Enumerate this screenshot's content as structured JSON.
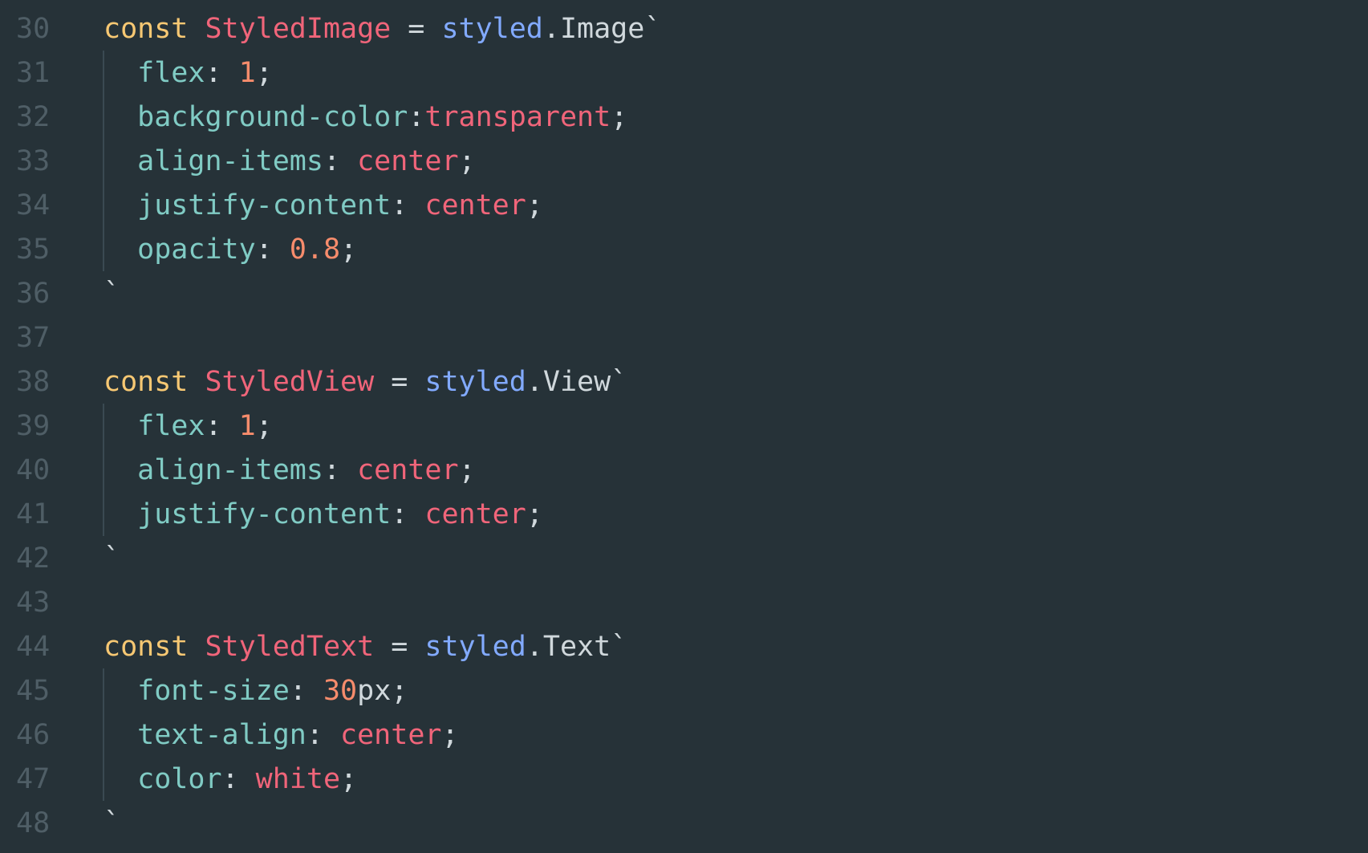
{
  "editor": {
    "background": "#263238",
    "colors": {
      "keyword": "#F7C873",
      "identifier": "#F0657A",
      "function": "#82AAFF",
      "property": "#80CBC4",
      "number": "#F78C6C",
      "value": "#F0657A",
      "punctuation": "#D0D8DC",
      "line_number": "#4F5E66"
    },
    "lines": [
      {
        "num": "30",
        "tokens": [
          {
            "t": "const",
            "c": "kw"
          },
          {
            "t": " "
          },
          {
            "t": "StyledImage",
            "c": "cls"
          },
          {
            "t": " = "
          },
          {
            "t": "styled",
            "c": "fn"
          },
          {
            "t": ".Image`"
          }
        ]
      },
      {
        "num": "31",
        "tokens": [
          {
            "t": "  "
          },
          {
            "t": "flex",
            "c": "prop"
          },
          {
            "t": ": "
          },
          {
            "t": "1",
            "c": "num"
          },
          {
            "t": ";"
          }
        ]
      },
      {
        "num": "32",
        "tokens": [
          {
            "t": "  "
          },
          {
            "t": "background-color",
            "c": "prop"
          },
          {
            "t": ":"
          },
          {
            "t": "transparent",
            "c": "val"
          },
          {
            "t": ";"
          }
        ]
      },
      {
        "num": "33",
        "tokens": [
          {
            "t": "  "
          },
          {
            "t": "align-items",
            "c": "prop"
          },
          {
            "t": ": "
          },
          {
            "t": "center",
            "c": "val"
          },
          {
            "t": ";"
          }
        ]
      },
      {
        "num": "34",
        "tokens": [
          {
            "t": "  "
          },
          {
            "t": "justify-content",
            "c": "prop"
          },
          {
            "t": ": "
          },
          {
            "t": "center",
            "c": "val"
          },
          {
            "t": ";"
          }
        ]
      },
      {
        "num": "35",
        "tokens": [
          {
            "t": "  "
          },
          {
            "t": "opacity",
            "c": "prop"
          },
          {
            "t": ": "
          },
          {
            "t": "0.8",
            "c": "num"
          },
          {
            "t": ";"
          }
        ]
      },
      {
        "num": "36",
        "tokens": [
          {
            "t": "`"
          }
        ]
      },
      {
        "num": "37",
        "tokens": []
      },
      {
        "num": "38",
        "tokens": [
          {
            "t": "const",
            "c": "kw"
          },
          {
            "t": " "
          },
          {
            "t": "StyledView",
            "c": "cls"
          },
          {
            "t": " = "
          },
          {
            "t": "styled",
            "c": "fn"
          },
          {
            "t": ".View`"
          }
        ]
      },
      {
        "num": "39",
        "tokens": [
          {
            "t": "  "
          },
          {
            "t": "flex",
            "c": "prop"
          },
          {
            "t": ": "
          },
          {
            "t": "1",
            "c": "num"
          },
          {
            "t": ";"
          }
        ]
      },
      {
        "num": "40",
        "tokens": [
          {
            "t": "  "
          },
          {
            "t": "align-items",
            "c": "prop"
          },
          {
            "t": ": "
          },
          {
            "t": "center",
            "c": "val"
          },
          {
            "t": ";"
          }
        ]
      },
      {
        "num": "41",
        "tokens": [
          {
            "t": "  "
          },
          {
            "t": "justify-content",
            "c": "prop"
          },
          {
            "t": ": "
          },
          {
            "t": "center",
            "c": "val"
          },
          {
            "t": ";"
          }
        ]
      },
      {
        "num": "42",
        "tokens": [
          {
            "t": "`"
          }
        ]
      },
      {
        "num": "43",
        "tokens": []
      },
      {
        "num": "44",
        "tokens": [
          {
            "t": "const",
            "c": "kw"
          },
          {
            "t": " "
          },
          {
            "t": "StyledText",
            "c": "cls"
          },
          {
            "t": " = "
          },
          {
            "t": "styled",
            "c": "fn"
          },
          {
            "t": ".Text`"
          }
        ]
      },
      {
        "num": "45",
        "tokens": [
          {
            "t": "  "
          },
          {
            "t": "font-size",
            "c": "prop"
          },
          {
            "t": ": "
          },
          {
            "t": "30",
            "c": "num"
          },
          {
            "t": "px;"
          }
        ]
      },
      {
        "num": "46",
        "tokens": [
          {
            "t": "  "
          },
          {
            "t": "text-align",
            "c": "prop"
          },
          {
            "t": ": "
          },
          {
            "t": "center",
            "c": "val"
          },
          {
            "t": ";"
          }
        ]
      },
      {
        "num": "47",
        "tokens": [
          {
            "t": "  "
          },
          {
            "t": "color",
            "c": "prop"
          },
          {
            "t": ": "
          },
          {
            "t": "white",
            "c": "val"
          },
          {
            "t": ";"
          }
        ]
      },
      {
        "num": "48",
        "tokens": [
          {
            "t": "`"
          }
        ]
      }
    ]
  }
}
